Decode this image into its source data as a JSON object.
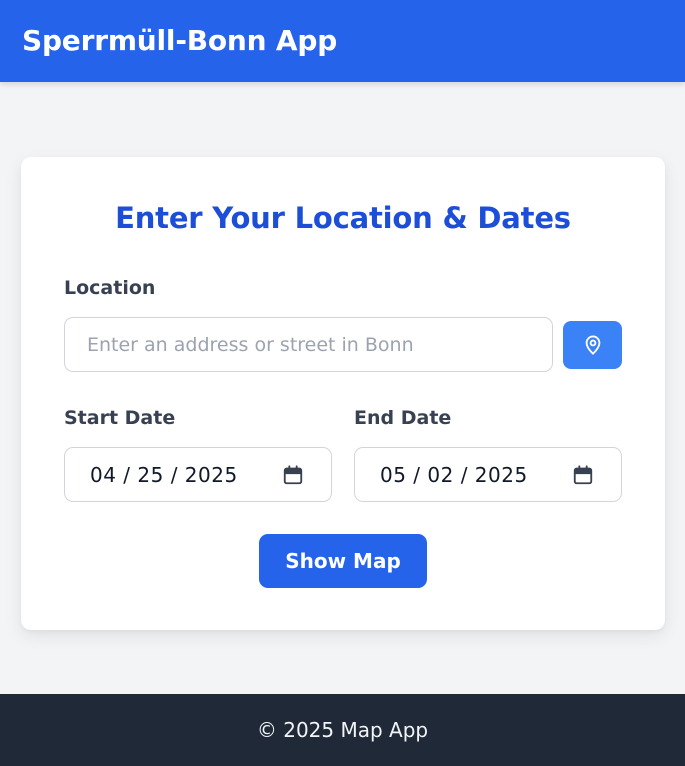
{
  "header": {
    "title": "Sperrmüll-Bonn App"
  },
  "form": {
    "title": "Enter Your Location & Dates",
    "location": {
      "label": "Location",
      "placeholder": "Enter an address or street in Bonn",
      "value": ""
    },
    "locate_button_icon": "map-pin-icon",
    "start_date": {
      "label": "Start Date",
      "value": "04 / 25 / 2025"
    },
    "end_date": {
      "label": "End Date",
      "value": "05 / 02 / 2025"
    },
    "date_icon": "calendar-icon",
    "submit_label": "Show Map"
  },
  "footer": {
    "text": "© 2025 Map App"
  },
  "colors": {
    "header_bg": "#2563eb",
    "title_blue": "#1d4ed8",
    "locate_button_bg": "#3b82f6",
    "submit_bg": "#2563eb",
    "page_bg": "#f3f4f6",
    "footer_bg": "#1f2937"
  }
}
